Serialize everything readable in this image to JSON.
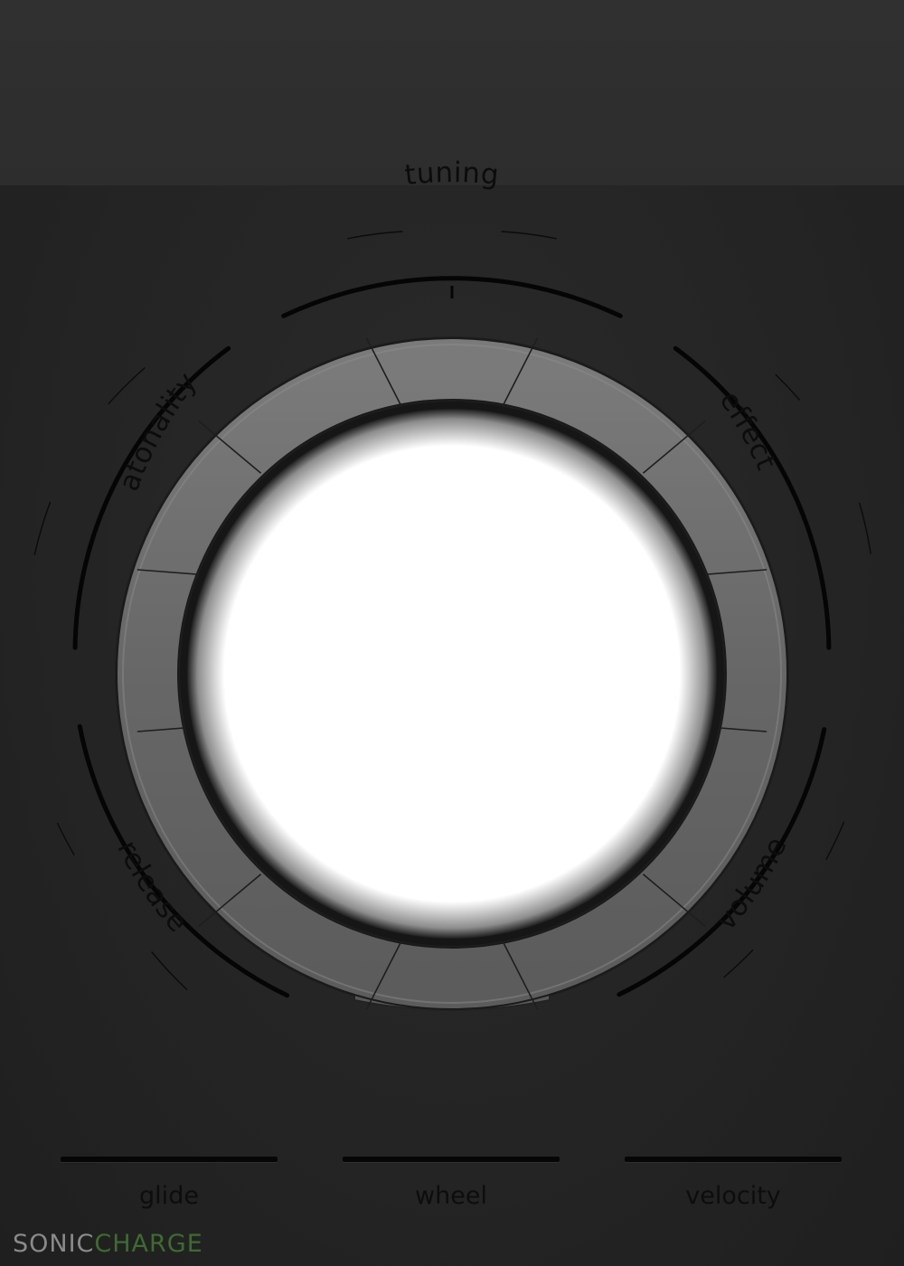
{
  "labels": {
    "tuning": "tuning",
    "atonality": "atonality",
    "effect": "effect",
    "release": "release",
    "volume": "volume"
  },
  "bottom": {
    "glide": "glide",
    "wheel": "wheel",
    "velocity": "velocity"
  },
  "brand": {
    "part1": "SONIC",
    "part2": "CHARGE"
  },
  "colors": {
    "background": "#2b2b2b",
    "ring": "#6e6e6e",
    "display": "#ffffff",
    "brand_accent": "#3e6b31"
  }
}
